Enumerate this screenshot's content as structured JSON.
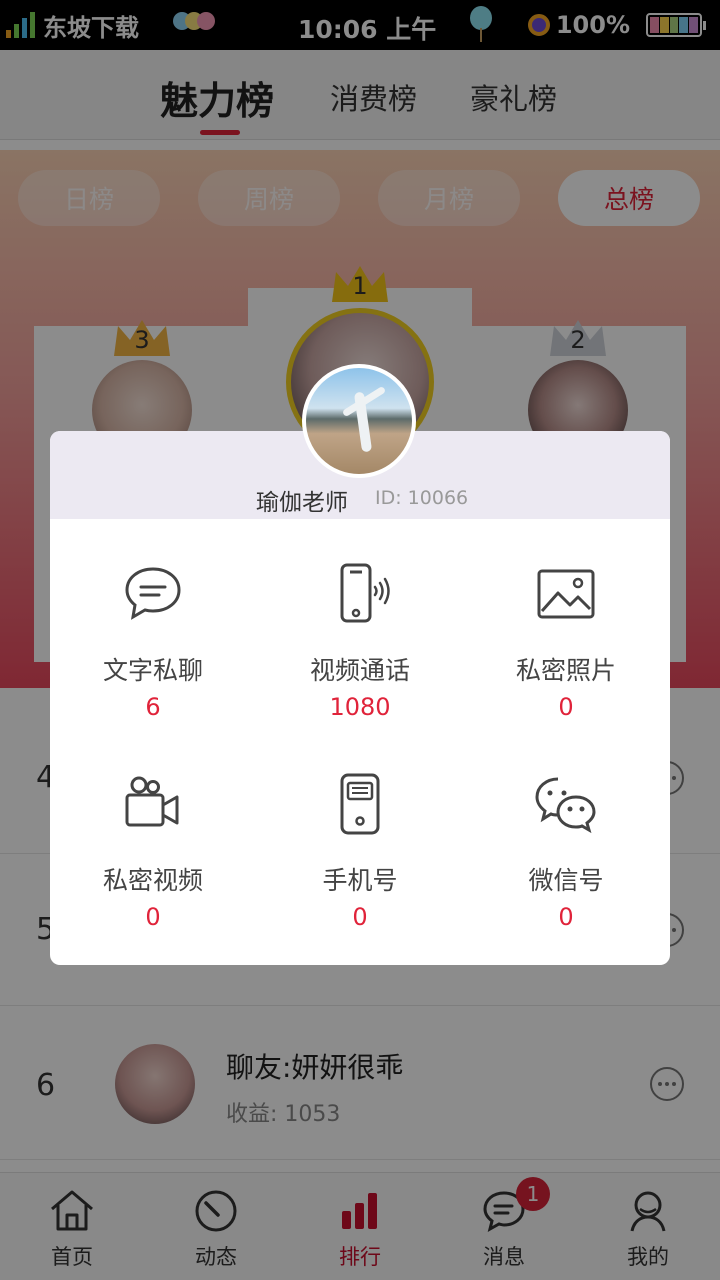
{
  "status_bar": {
    "carrier": "东坡下载",
    "time": "10:06 上午",
    "battery": "100%"
  },
  "top_tabs": [
    {
      "label": "魅力榜",
      "active": true
    },
    {
      "label": "消费榜",
      "active": false
    },
    {
      "label": "豪礼榜",
      "active": false
    }
  ],
  "period_tabs": [
    {
      "label": "日榜",
      "active": false
    },
    {
      "label": "周榜",
      "active": false
    },
    {
      "label": "月榜",
      "active": false
    },
    {
      "label": "总榜",
      "active": true
    }
  ],
  "podium": {
    "first": "1",
    "second": "2",
    "third": "3"
  },
  "list": [
    {
      "rank": "4"
    },
    {
      "rank": "5"
    },
    {
      "rank": "6",
      "name": "聊友:妍妍很乖",
      "income": "收益: 1053"
    }
  ],
  "dialog": {
    "name": "瑜伽老师",
    "id": "ID: 10066",
    "items": [
      {
        "label": "文字私聊",
        "value": "6",
        "icon": "chat-bubble-icon"
      },
      {
        "label": "视频通话",
        "value": "1080",
        "icon": "phone-call-icon"
      },
      {
        "label": "私密照片",
        "value": "0",
        "icon": "image-icon"
      },
      {
        "label": "私密视频",
        "value": "0",
        "icon": "video-camera-icon"
      },
      {
        "label": "手机号",
        "value": "0",
        "icon": "mobile-phone-icon"
      },
      {
        "label": "微信号",
        "value": "0",
        "icon": "wechat-icon"
      }
    ]
  },
  "bottom_nav": [
    {
      "label": "首页",
      "icon": "home-icon",
      "active": false
    },
    {
      "label": "动态",
      "icon": "gauge-icon",
      "active": false
    },
    {
      "label": "排行",
      "icon": "bar-chart-icon",
      "active": true
    },
    {
      "label": "消息",
      "icon": "message-icon",
      "active": false,
      "badge": "1"
    },
    {
      "label": "我的",
      "icon": "profile-icon",
      "active": false
    }
  ],
  "colors": {
    "accent": "#e0233a",
    "active_nav": "#c8102e"
  }
}
